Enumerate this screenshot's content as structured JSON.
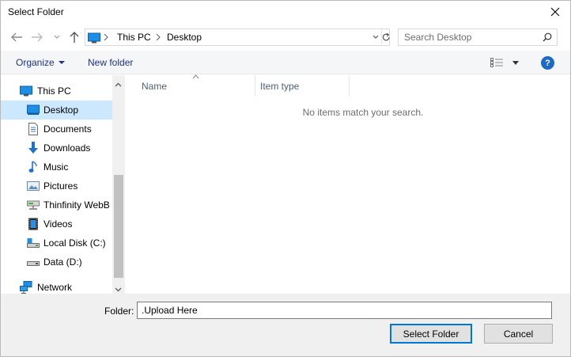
{
  "window": {
    "title": "Select Folder"
  },
  "address": {
    "crumbs": [
      "This PC",
      "Desktop"
    ]
  },
  "search": {
    "placeholder": "Search Desktop"
  },
  "commands": {
    "organize": "Organize",
    "new_folder": "New folder"
  },
  "help": {
    "label": "?"
  },
  "nav": {
    "items": [
      {
        "label": "This PC",
        "icon": "pc-icon"
      },
      {
        "label": "Desktop",
        "icon": "desktop-icon",
        "selected": true
      },
      {
        "label": "Documents",
        "icon": "documents-icon"
      },
      {
        "label": "Downloads",
        "icon": "downloads-icon"
      },
      {
        "label": "Music",
        "icon": "music-icon"
      },
      {
        "label": "Pictures",
        "icon": "pictures-icon"
      },
      {
        "label": "Thinfinity WebB",
        "icon": "network-drive-icon"
      },
      {
        "label": "Videos",
        "icon": "videos-icon"
      },
      {
        "label": "Local Disk (C:)",
        "icon": "local-disk-icon"
      },
      {
        "label": "Data (D:)",
        "icon": "drive-icon"
      },
      {
        "label": "Network",
        "icon": "network-icon"
      }
    ]
  },
  "columns": {
    "name": "Name",
    "type": "Item type"
  },
  "content": {
    "empty_message": "No items match your search."
  },
  "footer": {
    "folder_label": "Folder:",
    "folder_value": ".Upload Here",
    "select_button": "Select Folder",
    "cancel_button": "Cancel"
  },
  "colors": {
    "accent": "#0078d7",
    "link": "#1e3287",
    "selection": "#cce8ff"
  }
}
